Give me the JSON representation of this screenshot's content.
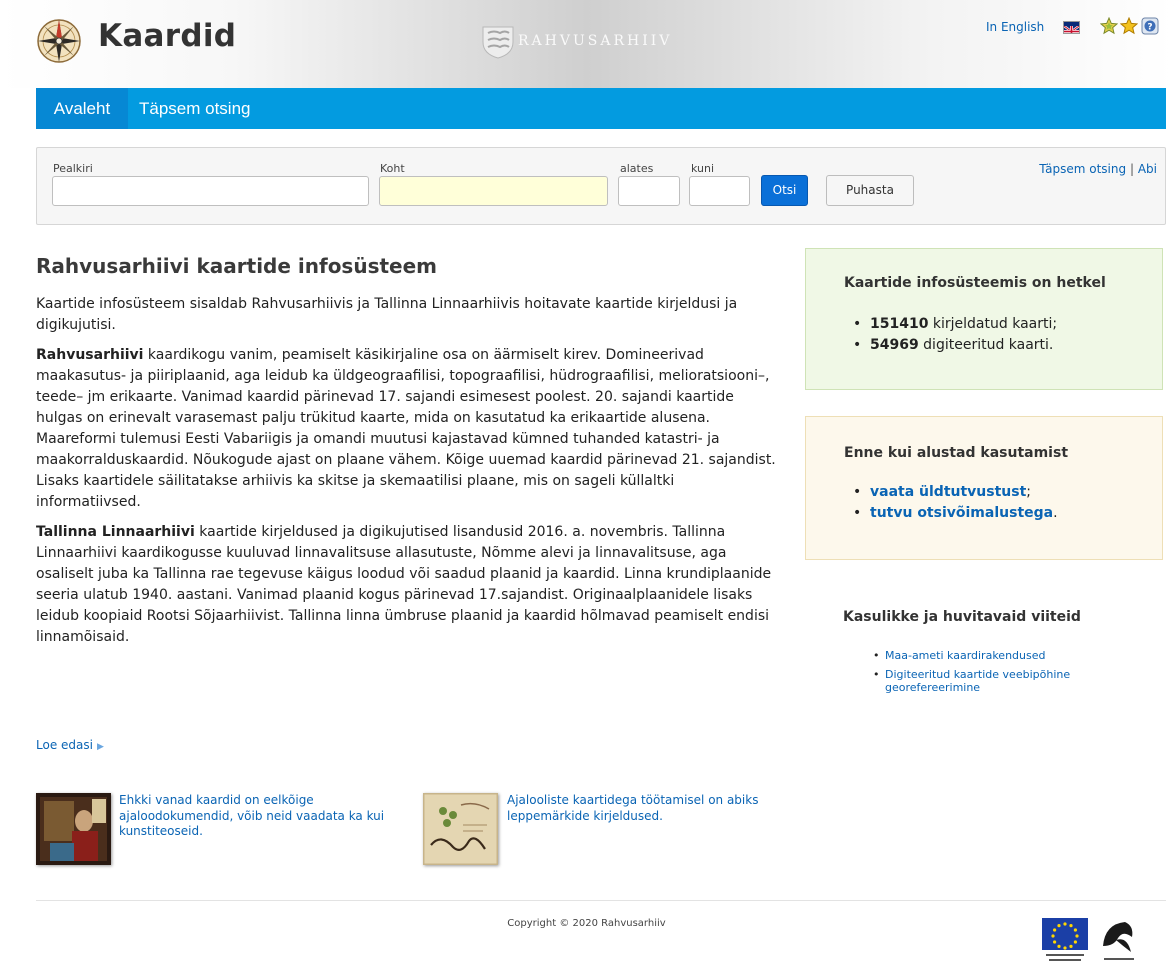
{
  "header": {
    "site_title": "Kaardid",
    "archive_name": "RAHVUSARHIIV",
    "language_link": "In English",
    "icons": [
      "compass-rose-icon",
      "archive-crest-icon",
      "uk-flag-icon",
      "star-outline-icon",
      "star-icon",
      "help-icon"
    ]
  },
  "nav": {
    "items": [
      {
        "label": "Avaleht",
        "active": true
      },
      {
        "label": "Täpsem otsing",
        "active": false
      }
    ]
  },
  "search": {
    "fields": {
      "pealkiri": {
        "label": "Pealkiri",
        "value": "",
        "placeholder": ""
      },
      "koht": {
        "label": "Koht",
        "value": "",
        "placeholder": ""
      },
      "alates": {
        "label": "alates",
        "value": "",
        "placeholder": ""
      },
      "kuni": {
        "label": "kuni",
        "value": "",
        "placeholder": ""
      }
    },
    "search_button": "Otsi",
    "clear_button": "Puhasta",
    "advanced_link": "Täpsem otsing",
    "separator": "|",
    "help_link": "Abi"
  },
  "main": {
    "title": "Rahvusarhiivi kaartide infosüsteem",
    "intro": "Kaartide infosüsteem sisaldab Rahvusarhiivis ja Tallinna Linnaarhiivis hoitavate kaartide kirjeldusi ja digikujutisi.",
    "p1_bold": "Rahvusarhiivi",
    "p1_text": " kaardikogu vanim, peamiselt käsikirjaline osa on äärmiselt kirev. Domineerivad maakasutus- ja piiriplaanid, aga leidub ka üldgeograafilisi, topograafilisi, hüdrograafilisi, melioratsiooni–, teede– jm erikaarte. Vanimad kaardid pärinevad 17. sajandi esimesest poolest. 20. sajandi kaartide hulgas on erinevalt varasemast palju trükitud kaarte, mida on kasutatud ka erikaartide alusena. Maareformi tulemusi Eesti Vabariigis ja omandi muutusi kajastavad kümned tuhanded katastri- ja maakorralduskaardid. Nõukogude ajast on plaane vähem. Kõige uuemad kaardid pärinevad 21. sajandist. Lisaks kaartidele säilitatakse arhiivis ka skitse ja skemaatilisi plaane, mis on sageli küllaltki informatiivsed.",
    "p2_bold": "Tallinna Linnaarhiivi",
    "p2_text": " kaartide kirjeldused ja digikujutised lisandusid 2016. a. novembris. Tallinna Linnaarhiivi kaardikogusse kuuluvad linnavalitsuse allasutuste, Nõmme alevi ja linnavalitsuse, aga osaliselt juba ka Tallinna rae tegevuse käigus loodud või saadud plaanid ja kaardid. Linna krundiplaanide seeria ulatub 1940. aastani. Vanimad plaanid kogus pärinevad 17.sajandist. Originaalplaanidele lisaks leidub koopiaid Rootsi Sõjaarhiivist. Tallinna linna ümbruse plaanid ja kaardid hõlmavad peamiselt endisi linnamõisaid.",
    "read_more": "Loe edasi",
    "teasers": [
      {
        "text": "Ehkki vanad kaardid on eelkõige ajaloodokumendid, võib neid vaadata ka kui kunstiteoseid."
      },
      {
        "text": "Ajalooliste kaartidega töötamisel on abiks leppemärkide kirjeldused."
      }
    ]
  },
  "sidebar": {
    "stats": {
      "title": "Kaartide infosüsteemis on hetkel",
      "items": [
        {
          "number": "151410",
          "text": " kirjeldatud kaarti;"
        },
        {
          "number": "54969",
          "text": " digiteeritud kaarti."
        }
      ]
    },
    "start": {
      "title": "Enne kui alustad kasutamist",
      "items": [
        {
          "link": "vaata üldtutvustust",
          "suffix": ";"
        },
        {
          "link": "tutvu otsivõimalustega",
          "suffix": "."
        }
      ]
    },
    "links": {
      "title": "Kasulikke ja huvitavaid viiteid",
      "items": [
        {
          "label": "Maa-ameti kaardirakendused"
        },
        {
          "label": "Digiteeritud kaartide veebipõhine georefereerimine"
        }
      ]
    }
  },
  "footer": {
    "copyright": "Copyright © 2020 Rahvusarhiiv"
  },
  "colors": {
    "nav_bg": "#039be0",
    "nav_active": "#0688d4",
    "link": "#0a64b4",
    "search_button": "#0a70d8",
    "stats_box": "#f0f8e6",
    "start_box": "#fdf8ec"
  }
}
